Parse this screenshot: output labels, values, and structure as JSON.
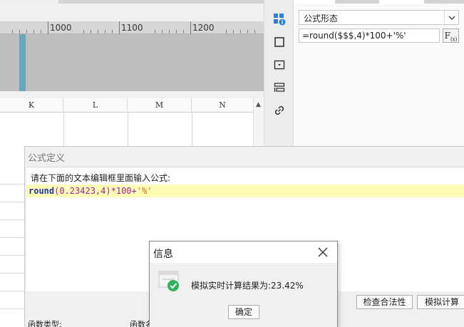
{
  "ruler": {
    "labels": [
      "1000",
      "1100",
      "1200"
    ]
  },
  "sheet": {
    "columns": [
      "K",
      "L",
      "M",
      "N"
    ]
  },
  "properties": {
    "formula_style_label": "公式形态",
    "formula_value": "=round($$$,4)*100+'%'",
    "fx_label": "F",
    "fx_sub": "(x)"
  },
  "formula_dialog": {
    "title": "公式定义",
    "prompt": "请在下面的文本编辑框里面输入公式:",
    "code": {
      "func": "round",
      "open": "(",
      "arg": "0.23423,4",
      "close": ")",
      "op": "*100+",
      "str": "'%'"
    },
    "check_button": "检查合法性",
    "simulate_button": "模拟计算",
    "function_type_label": "函数类型:",
    "function_name_label": "函数名"
  },
  "info_dialog": {
    "title": "信息",
    "message": "模拟实时计算结果为:23.42%",
    "ok_button": "确定"
  },
  "colors": {
    "highlight": "#fffcb6",
    "keyword": "#1f3aa6",
    "accent": "#2f7fd0",
    "success": "#2fb35a"
  }
}
